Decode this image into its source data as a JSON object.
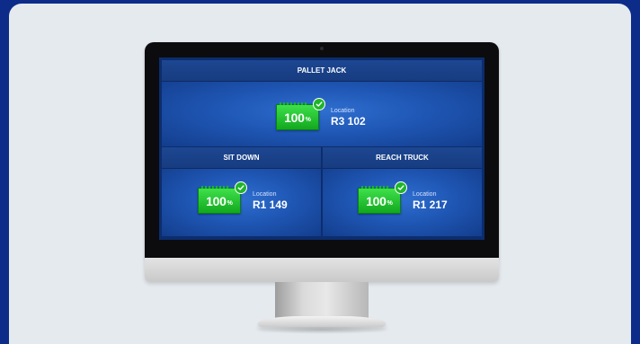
{
  "panels": {
    "top": {
      "title": "PALLET JACK",
      "battery": {
        "value": "100",
        "unit": "%",
        "level_percent": 100,
        "charged": true
      },
      "location": {
        "label": "Location",
        "value": "R3 102"
      }
    },
    "left": {
      "title": "SIT DOWN",
      "battery": {
        "value": "100",
        "unit": "%",
        "level_percent": 100,
        "charged": true
      },
      "location": {
        "label": "Location",
        "value": "R1 149"
      }
    },
    "right": {
      "title": "REACH TRUCK",
      "battery": {
        "value": "100",
        "unit": "%",
        "level_percent": 100,
        "charged": true
      },
      "location": {
        "label": "Location",
        "value": "R1 217"
      }
    }
  },
  "colors": {
    "background": "#0d2c8a",
    "card": "#e5eaee",
    "battery_green": "#1fb52b",
    "screen_blue": "#1f57b5"
  },
  "icons": [
    "battery-icon",
    "check-icon"
  ]
}
